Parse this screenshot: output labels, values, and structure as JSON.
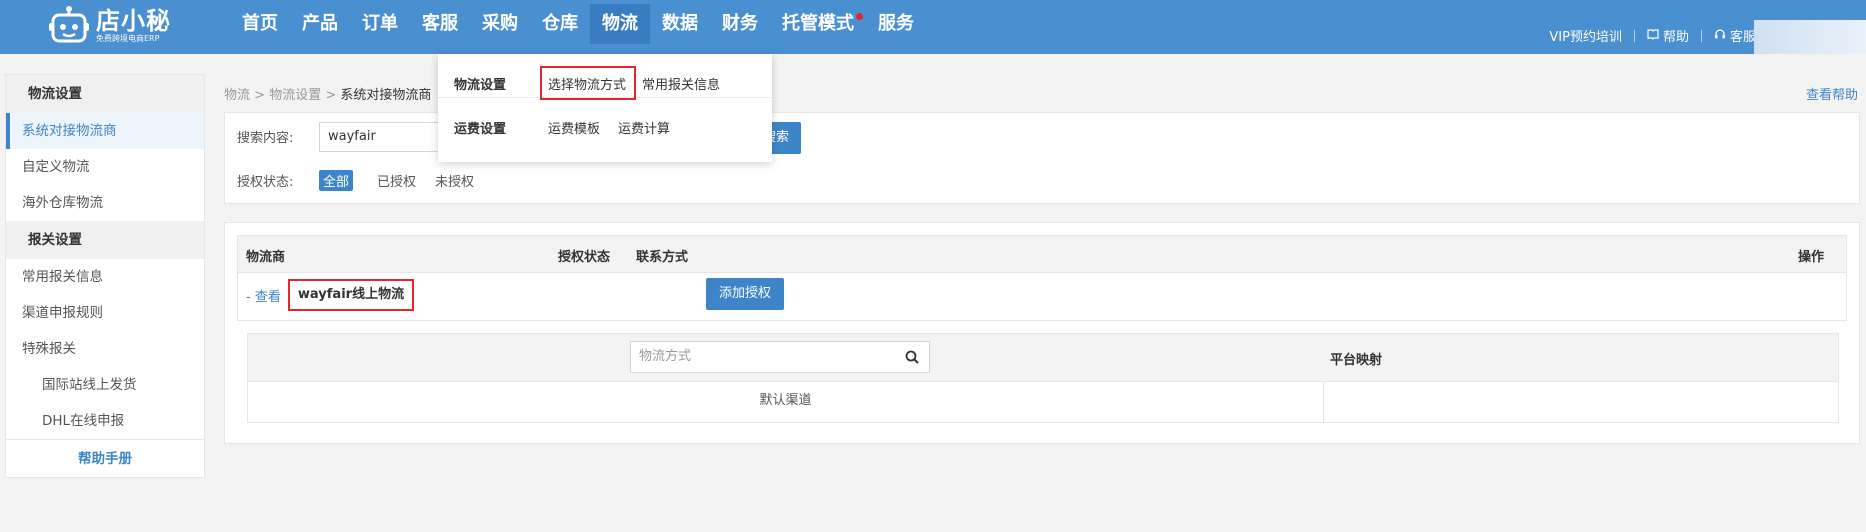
{
  "app": {
    "logo_title": "店小秘",
    "logo_subtitle": "免费跨境电商ERP",
    "brand_color": "#4a8fd0",
    "accent_color": "#3d85c8",
    "highlight_color": "#e7262b"
  },
  "topnav": {
    "items": [
      {
        "label": "首页"
      },
      {
        "label": "产品"
      },
      {
        "label": "订单"
      },
      {
        "label": "客服"
      },
      {
        "label": "采购"
      },
      {
        "label": "仓库"
      },
      {
        "label": "物流"
      },
      {
        "label": "数据"
      },
      {
        "label": "财务"
      },
      {
        "label": "托管模式"
      },
      {
        "label": "服务"
      }
    ],
    "active": "物流"
  },
  "rightnav": {
    "training": "VIP预约培训",
    "help": "帮助",
    "service": "客服"
  },
  "dropdown": {
    "row1": {
      "category": "物流设置",
      "links": [
        "选择物流方式",
        "常用报关信息"
      ]
    },
    "row2": {
      "category": "运费设置",
      "links": [
        "运费模板",
        "运费计算"
      ]
    }
  },
  "sidebar": {
    "group1": {
      "title": "物流设置",
      "items": [
        "系统对接物流商",
        "自定义物流",
        "海外仓库物流"
      ]
    },
    "group2": {
      "title": "报关设置",
      "items": [
        "常用报关信息",
        "渠道申报规则",
        "特殊报关"
      ]
    },
    "sub_items": [
      "国际站线上发货",
      "DHL在线申报"
    ],
    "help": "帮助手册",
    "active": "系统对接物流商"
  },
  "breadcrumb": {
    "parts": [
      "物流",
      "物流设置",
      "系统对接物流商"
    ],
    "help_link": "查看帮助"
  },
  "search": {
    "label": "搜索内容:",
    "value": "wayfair",
    "auth_label": "授权状态:",
    "filters": [
      "全部",
      "已授权",
      "未授权"
    ],
    "active_filter": "全部",
    "button_label": "搜索"
  },
  "table": {
    "headers": [
      "物流商",
      "授权状态",
      "联系方式",
      "操作"
    ],
    "row": {
      "toggle": "- 查看",
      "name": "wayfair线上物流",
      "action": "添加授权"
    },
    "sub_table": {
      "search_placeholder": "物流方式",
      "mapping_header": "平台映射",
      "default_channel": "默认渠道"
    }
  }
}
